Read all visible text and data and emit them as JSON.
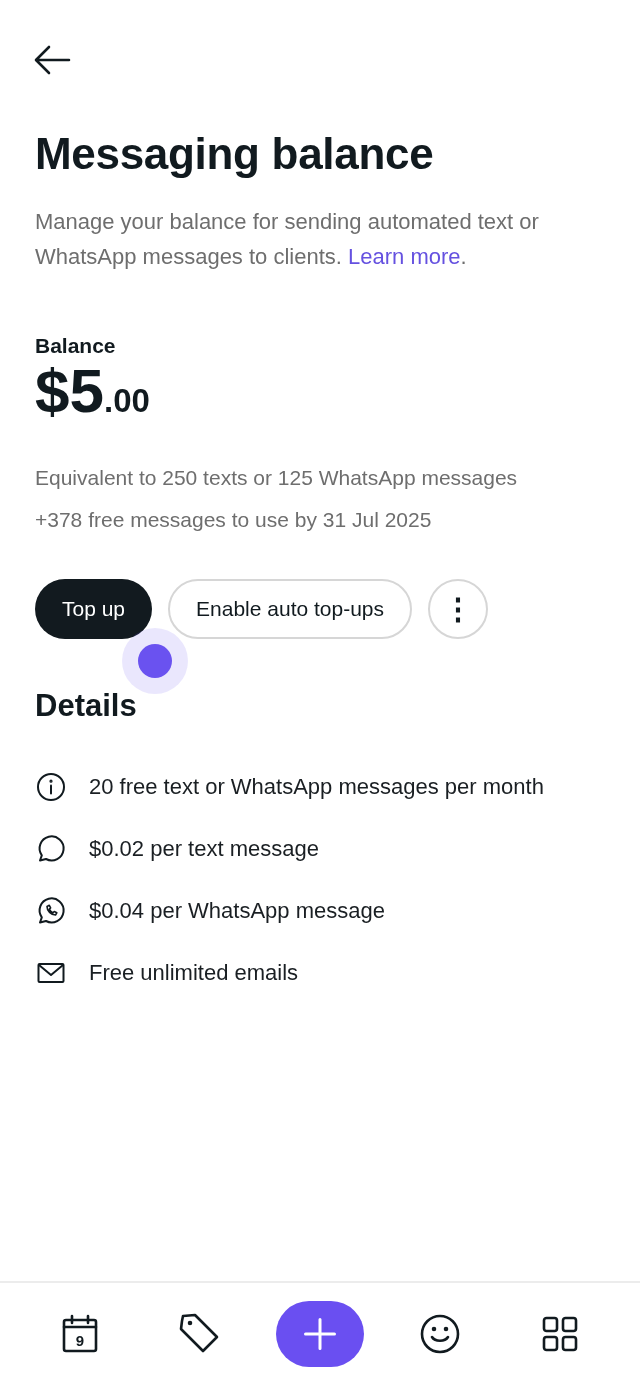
{
  "header": {
    "title": "Messaging balance",
    "description": {
      "text": "Manage your balance for sending automated text or WhatsApp messages to clients.",
      "link": "Learn more",
      "after": "."
    }
  },
  "balance": {
    "label": "Balance",
    "amount": "$5",
    "cents": ".00",
    "equivalent": "Equivalent to 250 texts or 125 WhatsApp messages",
    "free_messages": "+378 free messages to use by 31 Jul 2025"
  },
  "actions": [
    {
      "kind": "primary",
      "label": "Top up"
    },
    {
      "kind": "outline",
      "label": "Enable auto top-ups"
    },
    {
      "kind": "more",
      "label": "⋮"
    }
  ],
  "touch_indicator": true,
  "details": {
    "title": "Details",
    "items": [
      {
        "kind": "info",
        "text": "20 free text or WhatsApp messages per month"
      },
      {
        "kind": "chat",
        "text": "$0.02 per text message"
      },
      {
        "kind": "whatsapp",
        "text": "$0.04 per WhatsApp message"
      },
      {
        "kind": "mail",
        "text": "Free unlimited emails"
      }
    ]
  },
  "bottom_nav": [
    {
      "kind": "calendar",
      "day": "9"
    },
    {
      "kind": "tag"
    },
    {
      "kind": "add"
    },
    {
      "kind": "smiley"
    },
    {
      "kind": "grid"
    }
  ]
}
